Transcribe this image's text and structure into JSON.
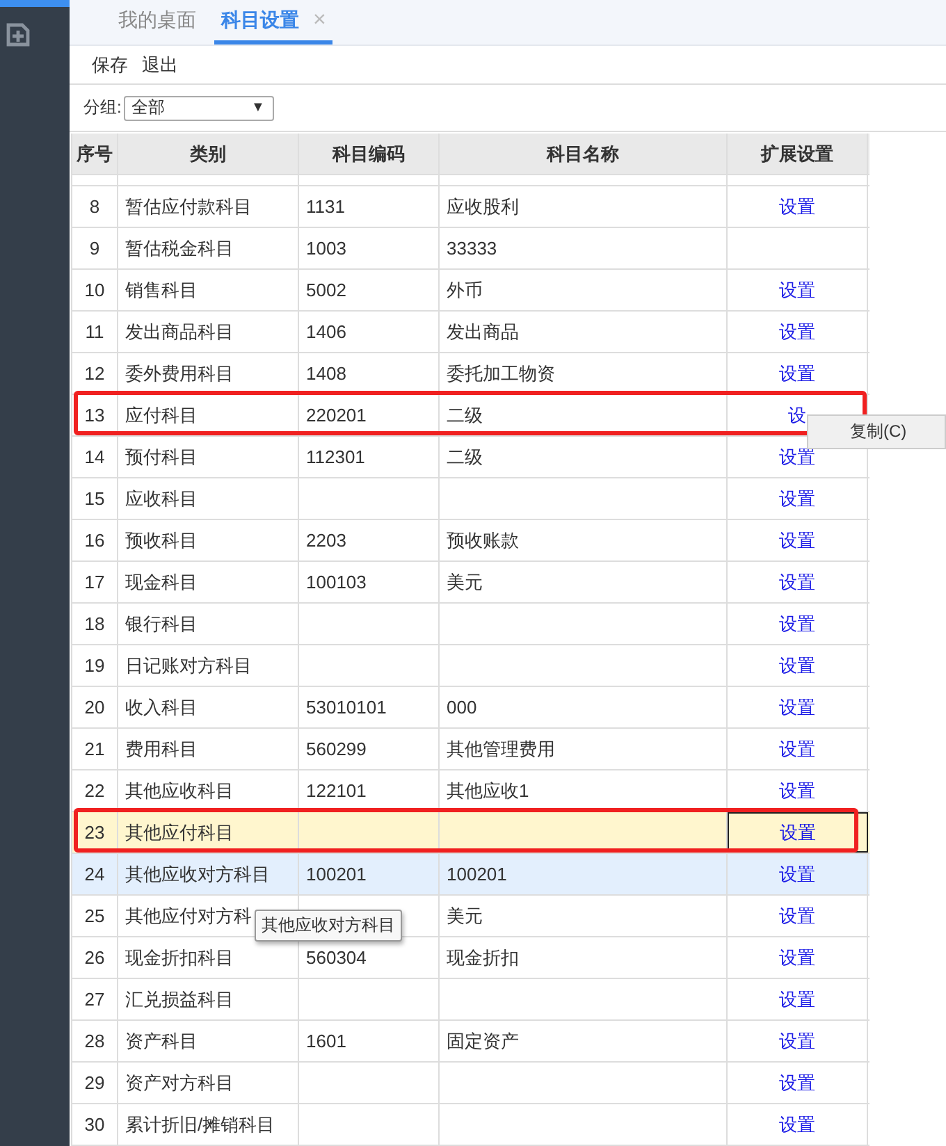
{
  "tabs": [
    {
      "label": "我的桌面",
      "selected": false
    },
    {
      "label": "科目设置",
      "selected": true,
      "close": "×"
    }
  ],
  "toolbar": [
    "保存",
    "退出"
  ],
  "filter": {
    "label": "分组:",
    "value": "全部",
    "arrow": "▼"
  },
  "table": {
    "columns": [
      "序号",
      "类别",
      "科目编码",
      "科目名称",
      "扩展设置"
    ],
    "rows": [
      {
        "no": "8",
        "category": "暂估应付款科目",
        "code": "1131",
        "name": "应收股利",
        "action": "设置",
        "selected": false,
        "hovered": false,
        "marked": false
      },
      {
        "no": "9",
        "category": "暂估税金科目",
        "code": "1003",
        "name": "33333",
        "selected": false,
        "hovered": false,
        "marked": false
      },
      {
        "no": "10",
        "category": "销售科目",
        "code": "5002",
        "name": "外币",
        "action": "设置",
        "selected": false,
        "hovered": false,
        "marked": false
      },
      {
        "no": "11",
        "category": "发出商品科目",
        "code": "1406",
        "name": "发出商品",
        "action": "设置",
        "selected": false,
        "hovered": false,
        "marked": false
      },
      {
        "no": "12",
        "category": "委外费用科目",
        "code": "1408",
        "name": "委托加工物资",
        "action": "设置",
        "selected": false,
        "hovered": false,
        "marked": false
      },
      {
        "no": "13",
        "category": "应付科目",
        "code": "220201",
        "name": "二级",
        "action": "设",
        "selected": false,
        "hovered": false,
        "marked": true
      },
      {
        "no": "14",
        "category": "预付科目",
        "code": "112301",
        "name": "二级",
        "action": "设置",
        "selected": false,
        "hovered": false,
        "marked": false
      },
      {
        "no": "15",
        "category": "应收科目",
        "action": "设置",
        "selected": false,
        "hovered": false,
        "marked": false
      },
      {
        "no": "16",
        "category": "预收科目",
        "code": "2203",
        "name": "预收账款",
        "action": "设置",
        "selected": false,
        "hovered": false,
        "marked": false
      },
      {
        "no": "17",
        "category": "现金科目",
        "code": "100103",
        "name": "美元",
        "action": "设置",
        "selected": false,
        "hovered": false,
        "marked": false
      },
      {
        "no": "18",
        "category": "银行科目",
        "action": "设置",
        "selected": false,
        "hovered": false,
        "marked": false
      },
      {
        "no": "19",
        "category": "日记账对方科目",
        "action": "设置",
        "selected": false,
        "hovered": false,
        "marked": false
      },
      {
        "no": "20",
        "category": "收入科目",
        "code": "53010101",
        "name": "000",
        "action": "设置",
        "selected": false,
        "hovered": false,
        "marked": false
      },
      {
        "no": "21",
        "category": "费用科目",
        "code": "560299",
        "name": "其他管理费用",
        "action": "设置",
        "selected": false,
        "hovered": false,
        "marked": false
      },
      {
        "no": "22",
        "category": "其他应收科目",
        "code": "122101",
        "name": "其他应收1",
        "action": "设置",
        "selected": false,
        "hovered": false,
        "marked": false
      },
      {
        "no": "23",
        "category": "其他应付科目",
        "action": "设置",
        "selected": true,
        "hovered": false,
        "marked": true
      },
      {
        "no": "24",
        "category": "其他应收对方科目",
        "code": "100201",
        "name": "100201",
        "action": "设置",
        "selected": false,
        "hovered": true,
        "marked": false
      },
      {
        "no": "25",
        "category": "其他应付对方科",
        "name": "美元",
        "action": "设置",
        "selected": false,
        "hovered": false,
        "marked": false
      },
      {
        "no": "26",
        "category": "现金折扣科目",
        "code": "560304",
        "name": "现金折扣",
        "action": "设置",
        "selected": false,
        "hovered": false,
        "marked": false
      },
      {
        "no": "27",
        "category": "汇兑损益科目",
        "action": "设置",
        "selected": false,
        "hovered": false,
        "marked": false
      },
      {
        "no": "28",
        "category": "资产科目",
        "code": "1601",
        "name": "固定资产",
        "action": "设置",
        "selected": false,
        "hovered": false,
        "marked": false
      },
      {
        "no": "29",
        "category": "资产对方科目",
        "action": "设置",
        "selected": false,
        "hovered": false,
        "marked": false
      },
      {
        "no": "30",
        "category": "累计折旧/摊销科目",
        "action": "设置",
        "selected": false,
        "hovered": false,
        "marked": false
      }
    ]
  },
  "context_menu": {
    "items": [
      "复制(C)"
    ]
  },
  "tooltip": "其他应收对方科目"
}
